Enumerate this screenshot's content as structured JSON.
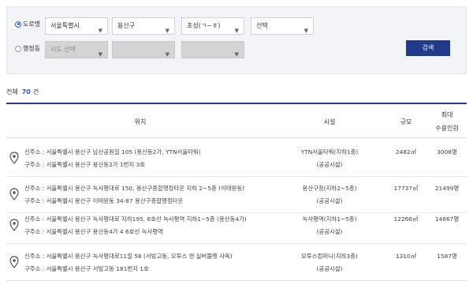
{
  "search": {
    "options": [
      {
        "label": "도로명",
        "checked": true
      },
      {
        "label": "행정동",
        "checked": false
      }
    ],
    "road": {
      "city": "서울특별시",
      "district": "용산구",
      "initial": "초성(ㄱ~ㅎ)",
      "select": "선택"
    },
    "admin": {
      "city": "시도 선택",
      "district": "",
      "dong": ""
    },
    "button_label": "검색"
  },
  "summary": {
    "prefix": "전체",
    "count": "70",
    "suffix": "건"
  },
  "table": {
    "headers": {
      "location": "위치",
      "facility": "시설",
      "scale": "규모",
      "capacity_line1": "최대",
      "capacity_line2": "수용인원"
    },
    "rows": [
      {
        "new_addr": "신주소 : 서울특별시 용산구 남산공원길 105 (용산동2가, YTN서울타워)",
        "old_addr": "구주소 : 서울특별시 용산구 용산동2가 1번지 3호",
        "facility": "YTN서울타워(지하1층)",
        "type": "(공공시설)",
        "scale": "2482㎡",
        "capacity": "3008명"
      },
      {
        "new_addr": "신주소 : 서울특별시 용산구 녹사평대로 150, 용산구종합행정타운 지하 2~5층 (이태원동)",
        "old_addr": "구주소 : 서울특별시 용산구 이태원동 34-87 용산구종합행정타운",
        "facility": "용산구청(지하2~5층)",
        "type": "(공공시설)",
        "scale": "17737㎡",
        "capacity": "21499명"
      },
      {
        "new_addr": "신주소 : 서울특별시 용산구 녹사평대로 지하195, 6호선 녹사평역 지하1~5층 (용산동4가)",
        "old_addr": "구주소 : 서울특별시 용산구 용산동4가 4 6호선 녹사평역",
        "facility": "녹사평역(지하1~5층)",
        "type": "(공공시설)",
        "scale": "12266㎡",
        "capacity": "14867명"
      },
      {
        "new_addr": "신주소 : 서울특별시 용산구 녹사평대로11길 58 (서빙고동, 모투스 앤 실버볼렛 사옥)",
        "old_addr": "구주소 : 서울특별시 용산구 서빙고동 181번지 1호",
        "facility": "모투스컴퍼니(지하3층)",
        "type": "(공공시설)",
        "scale": "1310㎡",
        "capacity": "1587명"
      }
    ]
  },
  "colors": {
    "accent": "#2a5bd7",
    "button": "#1f3b8a",
    "panel": "#f2f4f8"
  }
}
